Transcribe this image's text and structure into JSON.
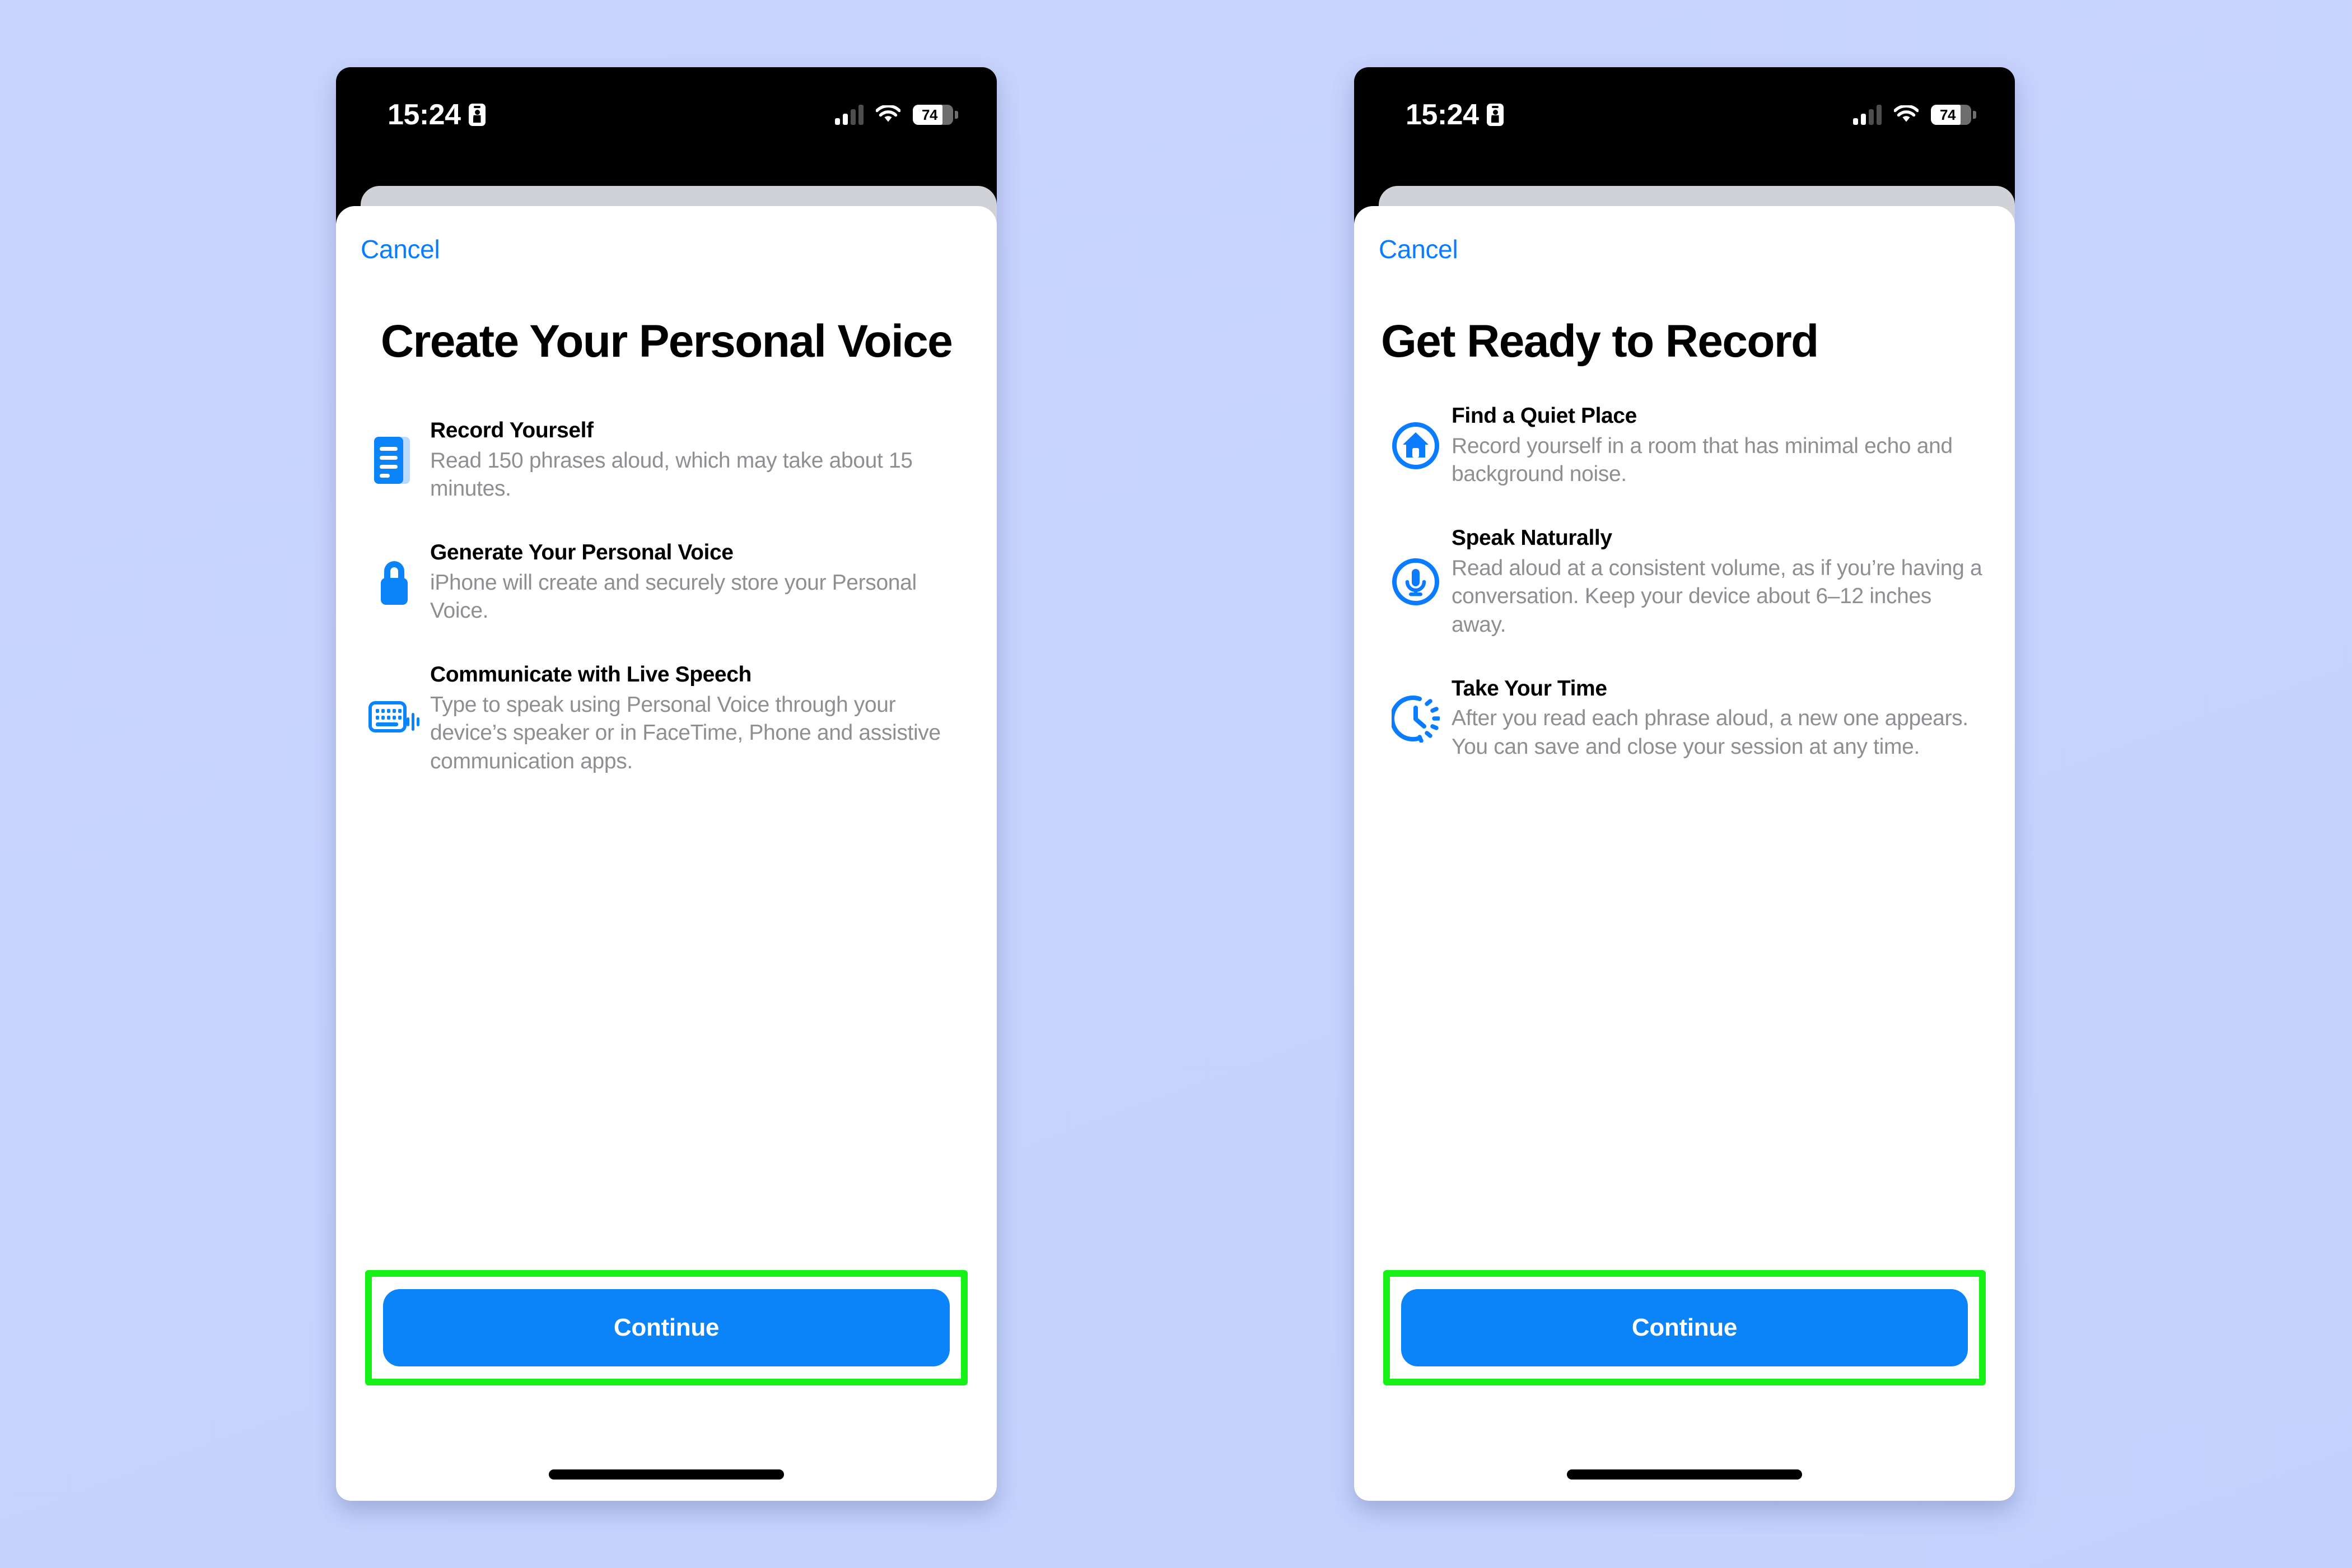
{
  "background": {
    "color_top": "#c9d4fd",
    "color_bottom": "#c3d2fc"
  },
  "accent": {
    "blue": "#0a84f8",
    "link_blue": "#0a7cff",
    "highlight_green": "#16f016",
    "muted_gray": "#8e8e93"
  },
  "status_bar": {
    "time": "15:24",
    "face_id_icon": "person-badge-icon",
    "signal_icon": "cellular-signal-icon",
    "wifi_icon": "wifi-icon",
    "battery_percent": "74",
    "battery_level": 74
  },
  "screens": [
    {
      "id": "create-personal-voice",
      "cancel_label": "Cancel",
      "title": "Create Your Personal Voice",
      "title_align": "center",
      "features": [
        {
          "icon": "document-lines-icon",
          "title": "Record Yourself",
          "desc": "Read 150 phrases aloud, which may take about 15 minutes."
        },
        {
          "icon": "lock-icon",
          "title": "Generate Your Personal Voice",
          "desc": "iPhone will create and securely store your Personal Voice."
        },
        {
          "icon": "keyboard-waveform-icon",
          "title": "Communicate with Live Speech",
          "desc": "Type to speak using Personal Voice through your device’s speaker or in FaceTime, Phone and assistive communication apps."
        }
      ],
      "cta_label": "Continue",
      "cta_highlighted": true
    },
    {
      "id": "get-ready-to-record",
      "cancel_label": "Cancel",
      "title": "Get Ready to Record",
      "title_align": "left",
      "features": [
        {
          "icon": "house-circle-icon",
          "title": "Find a Quiet Place",
          "desc": "Record yourself in a room that has minimal echo and background noise."
        },
        {
          "icon": "microphone-circle-icon",
          "title": "Speak Naturally",
          "desc": "Read aloud at a consistent volume, as if you’re having a conversation. Keep your device about 6–12 inches away."
        },
        {
          "icon": "clock-arrow-icon",
          "title": "Take Your Time",
          "desc": "After you read each phrase aloud, a new one appears. You can save and close your session at any time."
        }
      ],
      "cta_label": "Continue",
      "cta_highlighted": true
    }
  ]
}
